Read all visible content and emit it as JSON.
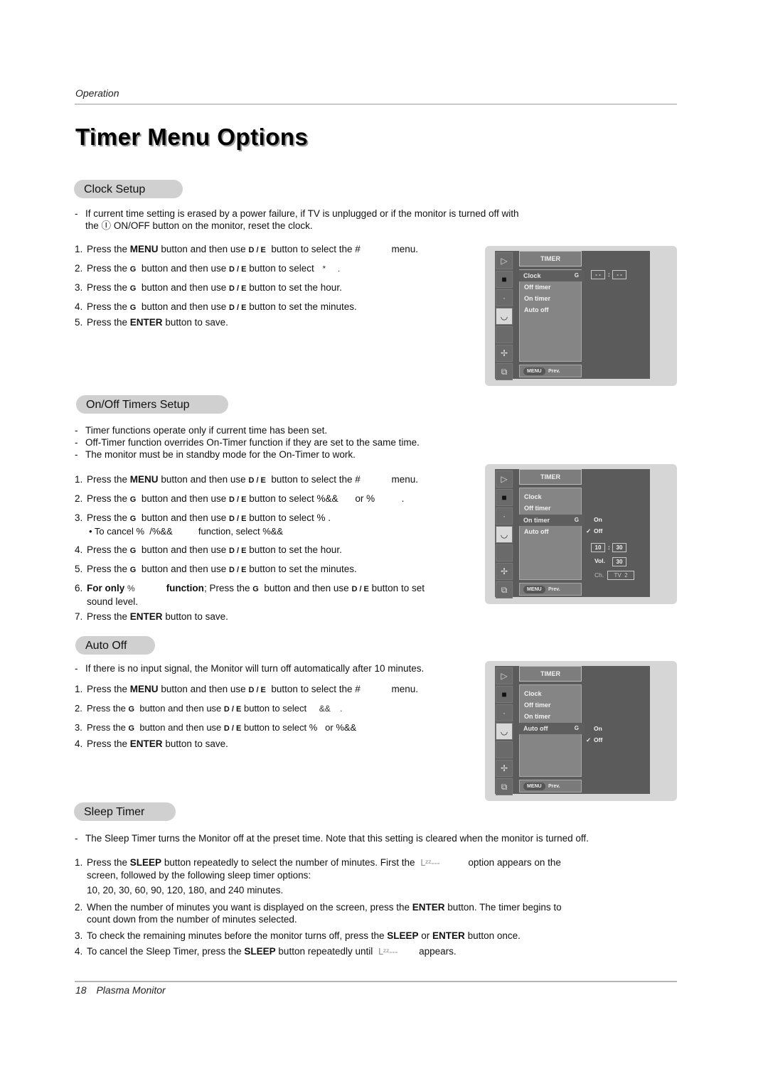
{
  "header": {
    "section": "Operation"
  },
  "page_title": "Timer Menu Options",
  "footer": {
    "page_number": "18",
    "product": "Plasma Monitor"
  },
  "clock_setup": {
    "heading": "Clock Setup",
    "notes": [
      {
        "dash": "-",
        "line1": "If current time setting is erased by a power failure, if TV is unplugged or if the monitor is turned off with",
        "line2_pre": "the",
        "power_glyph": "Ⓘ",
        "line2_post": "ON/OFF button on the monitor, reset the clock."
      }
    ],
    "steps": [
      {
        "n": "1.",
        "pre": "Press the",
        "bold": "MENU",
        "mid": "button and then use",
        "keys": "D / E",
        "post": "button to select the #",
        "tail": "menu."
      },
      {
        "n": "2.",
        "pre": "Press the",
        "key_g": "G",
        "mid": "button and then use",
        "keys": "D / E",
        "post": "button to select",
        "tail": "*     ."
      },
      {
        "n": "3.",
        "pre": "Press the",
        "key_g": "G",
        "mid": "button and then use",
        "keys": "D / E",
        "post": "button to set the hour."
      },
      {
        "n": "4.",
        "pre": "Press the",
        "key_g": "G",
        "mid": "button and then use",
        "keys": "D / E",
        "post": "button to set the minutes."
      },
      {
        "n": "5.",
        "pre": "Press the",
        "bold": "ENTER",
        "post": "button to save."
      }
    ],
    "osd": {
      "title": "TIMER",
      "items": [
        "Clock",
        "Off timer",
        "On timer",
        "Auto off"
      ],
      "selected_index": 0,
      "arrow": "G",
      "hour": "- -",
      "colon": ":",
      "minute": "- -",
      "menu_button": "MENU",
      "prev_label": "Prev."
    }
  },
  "onoff_setup": {
    "heading": "On/Off Timers Setup",
    "notes": [
      "Timer functions operate only if current time has been set.",
      "Off-Timer function overrides On-Timer function if they are set to the same time.",
      "The monitor must be in standby mode for the On-Timer to work."
    ],
    "steps": [
      {
        "n": "1.",
        "pre": "Press the",
        "bold": "MENU",
        "mid": "button and then use",
        "keys": "D / E",
        "post": "button to select the #",
        "tail": "menu."
      },
      {
        "n": "2.",
        "pre": "Press the",
        "key_g": "G",
        "mid": "button and then use",
        "keys": "D / E",
        "post": "button to select %&&",
        "tail": "or %          ."
      },
      {
        "n": "3.",
        "pre": "Press the",
        "key_g": "G",
        "mid": "button and then use",
        "keys": "D / E",
        "post": "button to select %  .",
        "sub": "• To cancel %  /%&&          function, select %&&"
      },
      {
        "n": "4.",
        "pre": "Press the",
        "key_g": "G",
        "mid": "button and then use",
        "keys": "D / E",
        "post": "button to set the hour."
      },
      {
        "n": "5.",
        "pre": "Press the",
        "key_g": "G",
        "mid": "button and then use",
        "keys": "D / E",
        "post": "button to set the minutes."
      },
      {
        "n": "6.",
        "bold_pre": "For only",
        "glyph": "%",
        "bold_mid": "function",
        "pre": "; Press the",
        "key_g": "G",
        "mid": "button and then use",
        "keys": "D / E",
        "post": "button to set",
        "line2": "sound level."
      },
      {
        "n": "7.",
        "pre": "Press the",
        "bold": "ENTER",
        "post": "button to save."
      }
    ],
    "osd": {
      "title": "TIMER",
      "items": [
        "Clock",
        "Off timer",
        "On timer",
        "Auto off"
      ],
      "selected_index": 2,
      "arrow": "G",
      "options": [
        "On",
        "Off"
      ],
      "checked_option": "Off",
      "check": "✓",
      "hour": "10",
      "colon": ":",
      "minute": "30",
      "vol_label": "Vol.",
      "vol_value": "30",
      "ch_label": "Ch.",
      "ch_value": "TV  2",
      "menu_button": "MENU",
      "prev_label": "Prev."
    }
  },
  "auto_off": {
    "heading": "Auto Off",
    "notes": [
      "If there is no input signal, the Monitor will turn off automatically after 10 minutes."
    ],
    "steps": [
      {
        "n": "1.",
        "pre": "Press the",
        "bold": "MENU",
        "mid": "button and then use",
        "keys": "D / E",
        "post": "button to select the #",
        "tail": "menu."
      },
      {
        "n": "2.",
        "pre": "Press the",
        "key_g": "G",
        "mid": "button and then use",
        "keys": "D / E",
        "post": "button to select",
        "tail": "&&    ."
      },
      {
        "n": "3.",
        "pre": "Press the",
        "key_g": "G",
        "mid": "button and then use",
        "keys": "D / E",
        "post": "button to select %   or %&&"
      },
      {
        "n": "4.",
        "pre": "Press the",
        "bold": "ENTER",
        "post": "button to save."
      }
    ],
    "osd": {
      "title": "TIMER",
      "items": [
        "Clock",
        "Off timer",
        "On timer",
        "Auto off"
      ],
      "selected_index": 3,
      "arrow": "G",
      "options": [
        "On",
        "Off"
      ],
      "checked_option": "Off",
      "check": "✓",
      "menu_button": "MENU",
      "prev_label": "Prev."
    }
  },
  "sleep_timer": {
    "heading": "Sleep Timer",
    "notes": [
      "The Sleep Timer turns the Monitor off at the preset time. Note that this setting is cleared when the monitor is turned off."
    ],
    "sleep_glyph": "ᒪᶻᶻ---",
    "steps": [
      {
        "n": "1.",
        "pre": "Press the",
        "bold": "SLEEP",
        "post": "button repeatedly to select the number of minutes. First the",
        "tail": "option appears on the",
        "line2": "screen, followed by the following sleep timer options:",
        "line3": "10, 20, 30, 60, 90, 120, 180, and 240 minutes."
      },
      {
        "n": "2.",
        "pre": "When the number of minutes you want is displayed on the screen, press the",
        "bold": "ENTER",
        "post": "button. The timer begins to",
        "line2": "count down from the number of minutes selected."
      },
      {
        "n": "3.",
        "pre": "To check the remaining minutes before the monitor turns off, press the",
        "bold": "SLEEP",
        "mid": "or",
        "bold2": "ENTER",
        "post": "button once."
      },
      {
        "n": "4.",
        "pre": "To cancel the Sleep Timer, press the",
        "bold": "SLEEP",
        "post": "button repeatedly until",
        "tail": "appears."
      }
    ]
  }
}
